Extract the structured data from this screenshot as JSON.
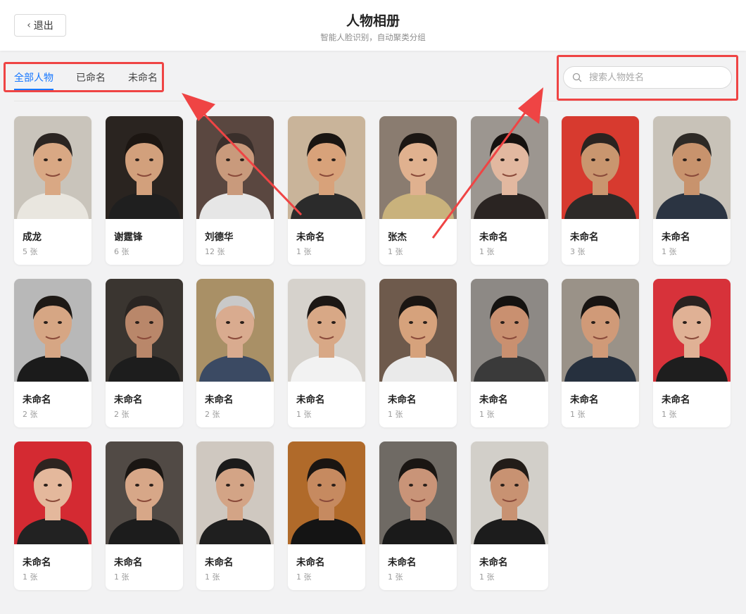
{
  "header": {
    "back_label": "退出",
    "title": "人物相册",
    "subtitle": "智能人脸识别，自动聚类分组"
  },
  "tabs": [
    {
      "label": "全部人物",
      "active": true
    },
    {
      "label": "已命名",
      "active": false
    },
    {
      "label": "未命名",
      "active": false
    }
  ],
  "search": {
    "placeholder": "搜索人物姓名",
    "value": ""
  },
  "colors": {
    "accent": "#1677ff",
    "highlight": "#ef4444"
  },
  "people": [
    {
      "name": "成龙",
      "count": "5 张",
      "bg": "#c9c4bb",
      "skin": "#d9a884",
      "hair": "#2b2522",
      "shirt": "#e9e6df"
    },
    {
      "name": "谢霆锋",
      "count": "6 张",
      "bg": "#2a2420",
      "skin": "#d2a07c",
      "hair": "#1c1612",
      "shirt": "#1f1f1f"
    },
    {
      "name": "刘德华",
      "count": "12 张",
      "bg": "#5a4740",
      "skin": "#c99a7c",
      "hair": "#3a2f2b",
      "shirt": "#e6e6e6"
    },
    {
      "name": "未命名",
      "count": "1 张",
      "bg": "#c9b49a",
      "skin": "#d8a27a",
      "hair": "#1a1512",
      "shirt": "#2b2b2b"
    },
    {
      "name": "张杰",
      "count": "1 张",
      "bg": "#8a7c70",
      "skin": "#e0b18f",
      "hair": "#1b1613",
      "shirt": "#c9b27c"
    },
    {
      "name": "未命名",
      "count": "1 张",
      "bg": "#9c9690",
      "skin": "#e2b8a0",
      "hair": "#15110f",
      "shirt": "#2a2422"
    },
    {
      "name": "未命名",
      "count": "3 张",
      "bg": "#d73a2f",
      "skin": "#c9966f",
      "hair": "#2a2320",
      "shirt": "#2d2a28"
    },
    {
      "name": "未命名",
      "count": "1 张",
      "bg": "#c8c2b8",
      "skin": "#c8936d",
      "hair": "#2e2a26",
      "shirt": "#2b3442"
    },
    {
      "name": "未命名",
      "count": "2 张",
      "bg": "#b8b8b8",
      "skin": "#d6a684",
      "hair": "#1e1915",
      "shirt": "#1b1b1b"
    },
    {
      "name": "未命名",
      "count": "2 张",
      "bg": "#3a3530",
      "skin": "#b9876a",
      "hair": "#2a2522",
      "shirt": "#1d1d1d"
    },
    {
      "name": "未命名",
      "count": "2 张",
      "bg": "#a99066",
      "skin": "#d9ab8f",
      "hair": "#c9c9c9",
      "shirt": "#3b4a63"
    },
    {
      "name": "未命名",
      "count": "1 张",
      "bg": "#d6d2cc",
      "skin": "#d8a886",
      "hair": "#1c1714",
      "shirt": "#f2f2f2"
    },
    {
      "name": "未命名",
      "count": "1 张",
      "bg": "#6e5a4c",
      "skin": "#d6a27c",
      "hair": "#1a1512",
      "shirt": "#eaeaea"
    },
    {
      "name": "未命名",
      "count": "1 张",
      "bg": "#8d8985",
      "skin": "#c99070",
      "hair": "#141210",
      "shirt": "#3a3a3a"
    },
    {
      "name": "未命名",
      "count": "1 张",
      "bg": "#9a9288",
      "skin": "#d09a78",
      "hair": "#181412",
      "shirt": "#26303e"
    },
    {
      "name": "未命名",
      "count": "1 张",
      "bg": "#d7323a",
      "skin": "#e0b195",
      "hair": "#2a2220",
      "shirt": "#1e1e1e"
    },
    {
      "name": "未命名",
      "count": "1 张",
      "bg": "#d42a32",
      "skin": "#e4b89c",
      "hair": "#2e2420",
      "shirt": "#222222"
    },
    {
      "name": "未命名",
      "count": "1 张",
      "bg": "#514a45",
      "skin": "#d7a788",
      "hair": "#1a1613",
      "shirt": "#1c1c1c"
    },
    {
      "name": "未命名",
      "count": "1 张",
      "bg": "#cfc8c0",
      "skin": "#d3a486",
      "hair": "#1b1b1b",
      "shirt": "#1f1f1f"
    },
    {
      "name": "未命名",
      "count": "1 张",
      "bg": "#b06a2a",
      "skin": "#c68a60",
      "hair": "#1a1512",
      "shirt": "#141414"
    },
    {
      "name": "未命名",
      "count": "1 张",
      "bg": "#6f6a64",
      "skin": "#c99478",
      "hair": "#1a1613",
      "shirt": "#1a1a1a"
    },
    {
      "name": "未命名",
      "count": "1 张",
      "bg": "#d2cfc9",
      "skin": "#c89272",
      "hair": "#221c18",
      "shirt": "#1c1c1c"
    }
  ]
}
